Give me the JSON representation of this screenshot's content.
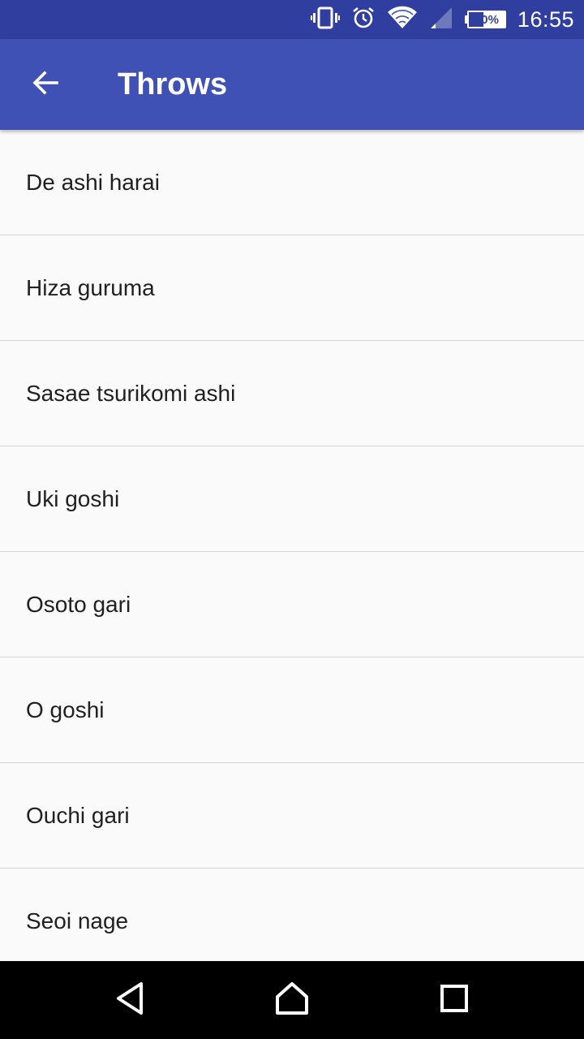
{
  "status_bar": {
    "battery_percent": "60%",
    "battery_level": 0.6,
    "time": "16:55",
    "icons": [
      "vibrate-icon",
      "alarm-icon",
      "wifi-icon",
      "cell-signal-icon",
      "battery-icon"
    ]
  },
  "app_bar": {
    "title": "Throws",
    "back_icon": "arrow-left-icon",
    "color": "#3f51b5"
  },
  "list": {
    "items": [
      {
        "label": "De ashi harai"
      },
      {
        "label": "Hiza guruma"
      },
      {
        "label": "Sasae tsurikomi ashi"
      },
      {
        "label": "Uki goshi"
      },
      {
        "label": "Osoto gari"
      },
      {
        "label": "O goshi"
      },
      {
        "label": "Ouchi gari"
      },
      {
        "label": "Seoi nage"
      }
    ]
  },
  "nav_bar": {
    "icons": [
      "nav-back-icon",
      "nav-home-icon",
      "nav-recents-icon"
    ]
  },
  "colors": {
    "status_bar": "#303f9f",
    "app_bar": "#3f51b5",
    "background": "#fafafa",
    "divider": "#d6d6d6",
    "text": "#212121"
  }
}
